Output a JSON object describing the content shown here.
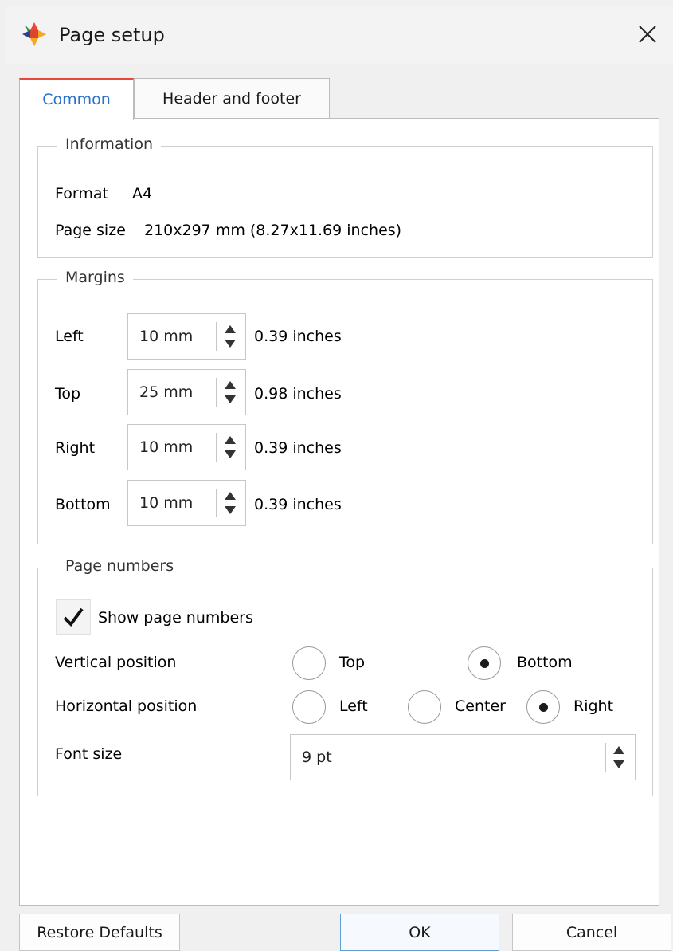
{
  "window": {
    "title": "Page setup",
    "app_icon": "app-logo-icon",
    "close_icon": "close-icon"
  },
  "tabs": [
    {
      "label": "Common",
      "active": true
    },
    {
      "label": "Header and footer",
      "active": false
    }
  ],
  "information": {
    "title": "Information",
    "format_label": "Format",
    "format_value": "A4",
    "page_size_label": "Page size",
    "page_size_value": "210x297 mm (8.27x11.69 inches)"
  },
  "margins": {
    "title": "Margins",
    "rows": [
      {
        "label": "Left",
        "value": "10 mm",
        "inches": "0.39 inches"
      },
      {
        "label": "Top",
        "value": "25 mm",
        "inches": "0.98 inches"
      },
      {
        "label": "Right",
        "value": "10 mm",
        "inches": "0.39 inches"
      },
      {
        "label": "Bottom",
        "value": "10 mm",
        "inches": "0.39 inches"
      }
    ]
  },
  "page_numbers": {
    "title": "Page numbers",
    "show_label": "Show page numbers",
    "show_checked": true,
    "vertical_label": "Vertical position",
    "vertical_options": [
      "Top",
      "Bottom"
    ],
    "vertical_selected": "Bottom",
    "horizontal_label": "Horizontal position",
    "horizontal_options": [
      "Left",
      "Center",
      "Right"
    ],
    "horizontal_selected": "Right",
    "font_size_label": "Font size",
    "font_size_value": "9 pt"
  },
  "buttons": {
    "restore": "Restore Defaults",
    "ok": "OK",
    "cancel": "Cancel"
  },
  "colors": {
    "accent_text": "#2a72c9",
    "tab_marker": "#e9463e",
    "ok_border": "#5f9ed8"
  }
}
